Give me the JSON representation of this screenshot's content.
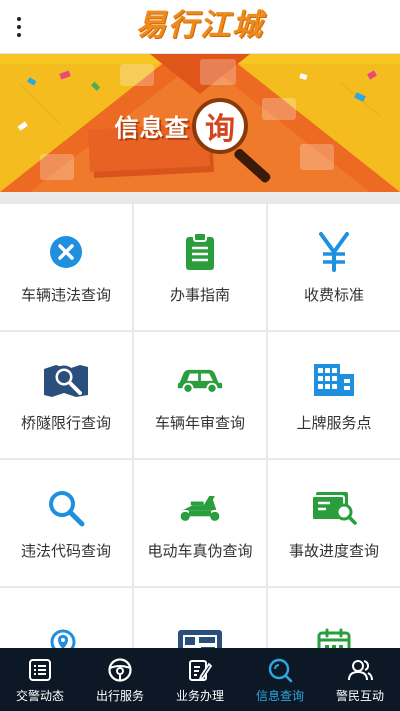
{
  "header": {
    "logo_text": "易行江城",
    "menu_icon": "more-vertical-icon"
  },
  "banner": {
    "title": "信息查",
    "magnifier_char": "询",
    "colors": {
      "background": "#f7c623",
      "accent": "#ec6a22"
    }
  },
  "grid": {
    "items": [
      {
        "label": "车辆违法查询",
        "icon": "x-circle-icon",
        "color": "#1f8fe0"
      },
      {
        "label": "办事指南",
        "icon": "clipboard-icon",
        "color": "#2a9d3c"
      },
      {
        "label": "收费标准",
        "icon": "yen-icon",
        "color": "#1f8fe0"
      },
      {
        "label": "桥隧限行查询",
        "icon": "magnifier-map-icon",
        "color": "#2b4f7c"
      },
      {
        "label": "车辆年审查询",
        "icon": "car-icon",
        "color": "#2a9d3c"
      },
      {
        "label": "上牌服务点",
        "icon": "building-icon",
        "color": "#1f8fe0"
      },
      {
        "label": "违法代码查询",
        "icon": "search-icon",
        "color": "#1f8fe0"
      },
      {
        "label": "电动车真伪查询",
        "icon": "scooter-icon",
        "color": "#2a9d3c"
      },
      {
        "label": "事故进度查询",
        "icon": "card-search-icon",
        "color": "#2a9d3c"
      },
      {
        "label": "",
        "icon": "location-search-icon",
        "color": "#1f8fe0"
      },
      {
        "label": "",
        "icon": "map-board-icon",
        "color": "#2b4f7c"
      },
      {
        "label": "",
        "icon": "calendar-icon",
        "color": "#2a9d3c"
      }
    ]
  },
  "nav": {
    "items": [
      {
        "label": "交警动态",
        "icon": "news-list-icon"
      },
      {
        "label": "出行服务",
        "icon": "steering-wheel-icon"
      },
      {
        "label": "业务办理",
        "icon": "edit-document-icon"
      },
      {
        "label": "信息查询",
        "icon": "search-circle-icon",
        "active": true
      },
      {
        "label": "警民互动",
        "icon": "users-icon"
      }
    ],
    "active_color": "#2fa8e0"
  }
}
